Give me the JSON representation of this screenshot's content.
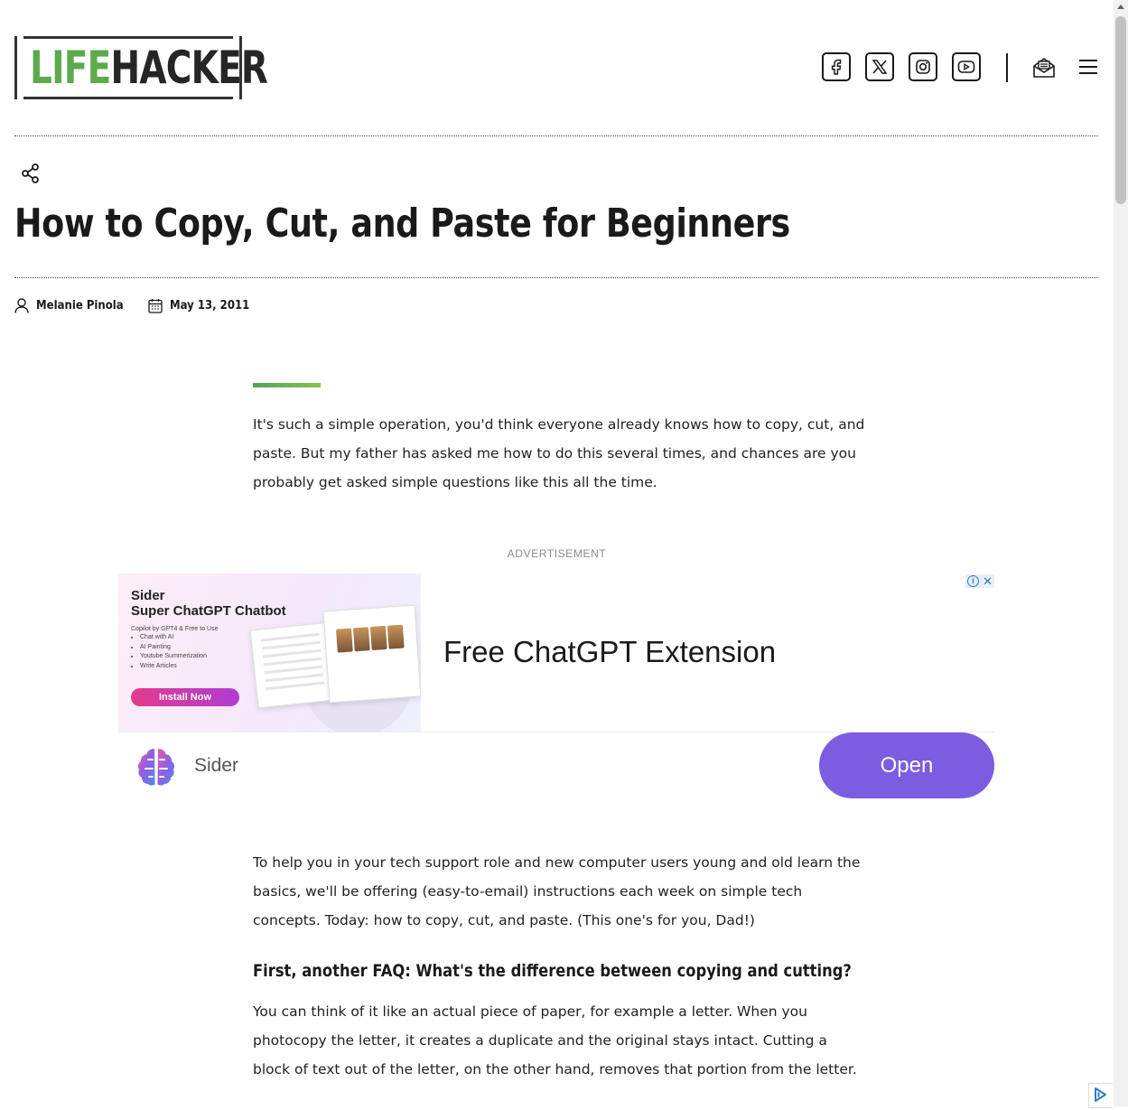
{
  "site": {
    "logo_left": "LIFE",
    "logo_right": "HACKER"
  },
  "header": {
    "social": [
      "facebook",
      "x",
      "instagram",
      "youtube"
    ],
    "newsletter_icon": "mail-icon",
    "menu_icon": "hamburger-icon"
  },
  "article": {
    "title": "How to Copy, Cut, and Paste for Beginners",
    "author": "Melanie Pinola",
    "date": "May 13, 2011",
    "para1": "It's such a simple operation, you'd think everyone already knows how to copy, cut, and paste. But my father has asked me how to do this several times, and chances are you probably get asked simple questions like this all the time.",
    "para2": "To help you in your tech support role and new computer users young and old learn the basics, we'll be offering (easy-to-email) instructions each week on simple tech concepts. Today: how to copy, cut, and paste. (This one's for you, Dad!)",
    "subhead": "First, another FAQ: What's the difference between copying and cutting?",
    "para3": "You can think of it like an actual piece of paper, for example a letter. When you photocopy the letter, it creates a duplicate and the original stays intact. Cutting a block of text out of the letter, on the other hand, removes that portion from the letter."
  },
  "ad": {
    "label": "ADVERTISEMENT",
    "creative_brand": "Sider",
    "creative_title": "Super ChatGPT Chatbot",
    "creative_sub": "Copilot by GPT4 & Free to Use",
    "creative_bullets": [
      "Chat with AI",
      "AI Painting",
      "Youtube Summerization",
      "Write Articles"
    ],
    "creative_cta": "Install Now",
    "headline": "Free ChatGPT Extension",
    "advertiser": "Sider",
    "cta": "Open",
    "adchoice_i": "i",
    "adchoice_x": "✕"
  },
  "colors": {
    "brand_green": "#5daa4d",
    "cta_purple": "#7c5ce0"
  }
}
